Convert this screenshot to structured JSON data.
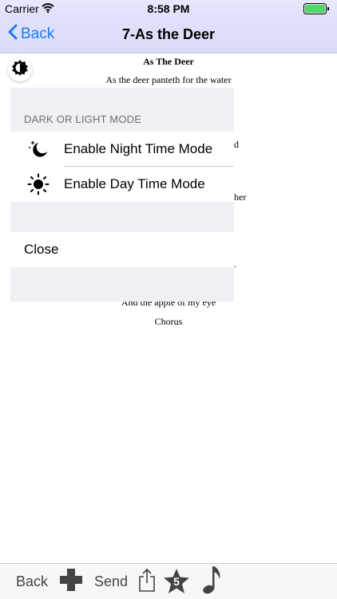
{
  "status_bar": {
    "carrier": "Carrier",
    "time": "8:58 PM"
  },
  "nav": {
    "back_label": "Back",
    "title": "7-As the Deer"
  },
  "document": {
    "title": "As The Deer",
    "line1": "As the deer panteth for the water",
    "partial_d": "d",
    "partial_her": "her",
    "partial_dot": ".",
    "line_apple": "And the apple of my eye",
    "chorus": "Chorus"
  },
  "popover": {
    "section_header": "DARK OR LIGHT MODE",
    "night_label": "Enable Night Time Mode",
    "day_label": "Enable Day Time Mode",
    "close_label": "Close"
  },
  "toolbar": {
    "back_label": "Back",
    "send_label": "Send",
    "badge_count": "5"
  },
  "colors": {
    "accent": "#1a7cf5",
    "nav_bg": "#e0e0fb",
    "group_bg": "#efeff4"
  }
}
